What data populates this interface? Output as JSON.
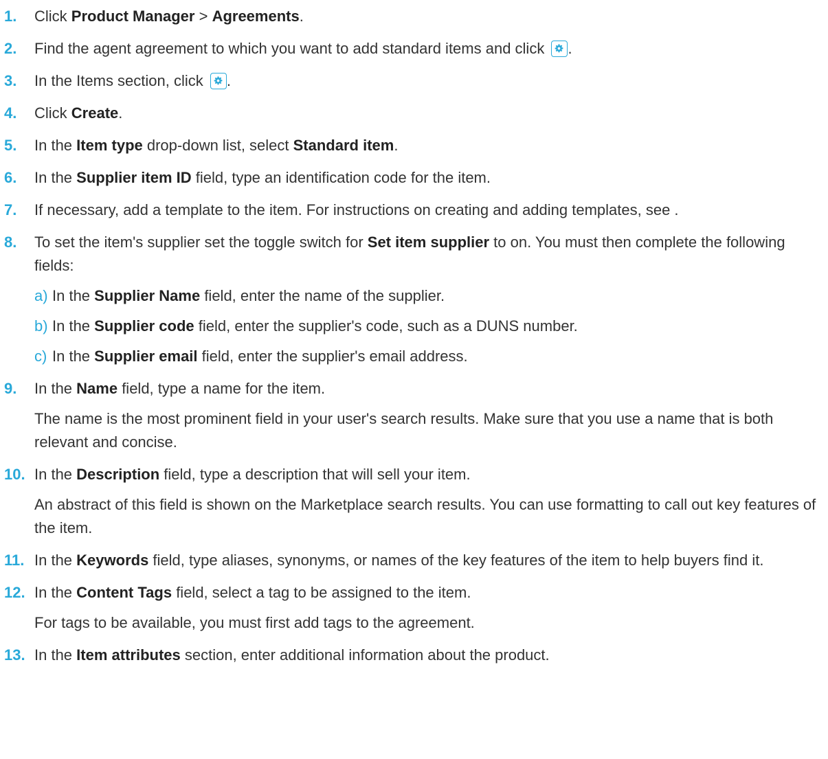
{
  "colors": {
    "accent": "#29a9d9",
    "text": "#333333"
  },
  "icons": {
    "settings": "gear-icon"
  },
  "steps": [
    {
      "num": "1.",
      "t1": "Click ",
      "b1": "Product Manager",
      "t2": " > ",
      "b2": "Agreements",
      "t3": "."
    },
    {
      "num": "2.",
      "t1": "Find the agent agreement to which you want to add standard items and click ",
      "t2": "."
    },
    {
      "num": "3.",
      "t1": "In the Items section, click ",
      "t2": "."
    },
    {
      "num": "4.",
      "t1": "Click ",
      "b1": "Create",
      "t2": "."
    },
    {
      "num": "5.",
      "t1": "In the ",
      "b1": "Item type",
      "t2": " drop-down list, select ",
      "b2": "Standard item",
      "t3": "."
    },
    {
      "num": "6.",
      "t1": "In the ",
      "b1": "Supplier item ID",
      "t2": " field, type an identification code for the item."
    },
    {
      "num": "7.",
      "t1": "If necessary, add a template to the item. For instructions on creating and adding templates, see ."
    },
    {
      "num": "8.",
      "t1": "To set the item's supplier set the toggle switch for ",
      "b1": "Set item supplier",
      "t2": " to on. You must then complete the following fields:",
      "subs": [
        {
          "letter": "a)",
          "t1": "In the ",
          "b1": "Supplier Name",
          "t2": " field, enter the name of the supplier."
        },
        {
          "letter": "b)",
          "t1": "In the ",
          "b1": "Supplier code",
          "t2": " field, enter the supplier's code, such as a DUNS number."
        },
        {
          "letter": "c)",
          "t1": "In the ",
          "b1": "Supplier email",
          "t2": " field, enter the supplier's email address."
        }
      ]
    },
    {
      "num": "9.",
      "t1": "In the ",
      "b1": "Name",
      "t2": " field, type a name for the item.",
      "note": "The name is the most prominent field in your user's search results. Make sure that you use a name that is both relevant and concise."
    },
    {
      "num": "10.",
      "t1": "In the ",
      "b1": "Description",
      "t2": " field, type a description that will sell your item.",
      "note": "An abstract of this field is shown on the Marketplace search results. You can use formatting to call out key features of the item."
    },
    {
      "num": "11.",
      "t1": "In the ",
      "b1": "Keywords",
      "t2": " field, type aliases, synonyms, or names of the key features of the item to help buyers find it."
    },
    {
      "num": "12.",
      "t1": "In the ",
      "b1": "Content Tags",
      "t2": " field, select a tag to be assigned to the item.",
      "note": "For tags to be available, you must first add tags to the agreement."
    },
    {
      "num": "13.",
      "t1": "In the ",
      "b1": "Item attributes",
      "t2": " section, enter additional information about the product."
    }
  ]
}
